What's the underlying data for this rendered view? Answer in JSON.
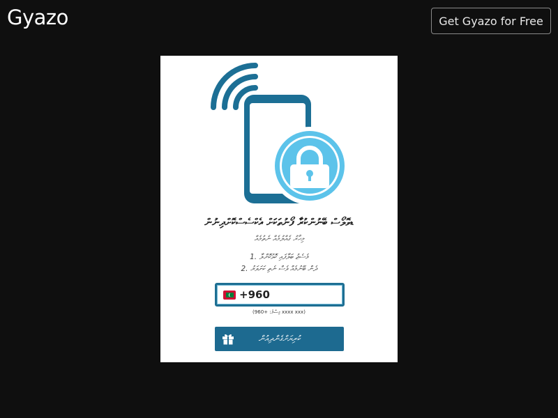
{
  "header": {
    "logo_text": "Gyazo",
    "cta_label": "Get Gyazo for Free"
  },
  "card": {
    "title": "ޑވޮލޯސް ބޭނުންކުރާ ފޯނުތަކަށް އެކްސެސްކޮށްދިނުން",
    "subtitle": "މިހާރު ގެއްލުމެއް ނެތުމެއް",
    "step1": "1. މެސެޖު ބަލާފައި ކޮޅުކޮށްލާ",
    "step2": "2. ދެން ބޭނުމެއް ވެސް ނެތި ކަށަވަރު",
    "phone_prefix": "+960",
    "phone_hint": "(މިސާލު: +960 xxxx xxx)",
    "submit_label": "ކުރިޔަށްގެންދިއުން",
    "flag": "maldives-flag"
  },
  "colors": {
    "page_bg": "#0f0f0f",
    "accent": "#1d6a90",
    "phone_blue": "#1c6f95",
    "lock_blue": "#5cc3ea"
  },
  "icons": {
    "illustration": "phone-lock-signal-icon",
    "submit": "gift-icon"
  }
}
